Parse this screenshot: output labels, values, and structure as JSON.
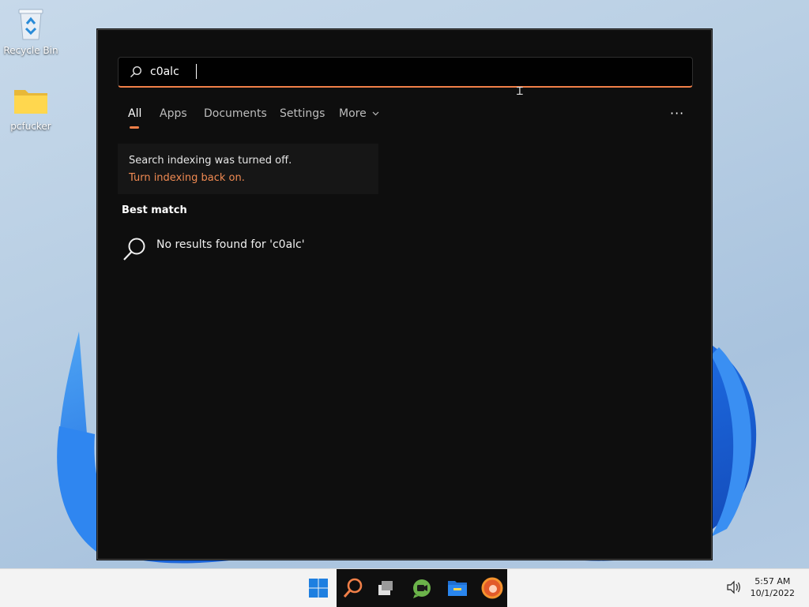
{
  "desktop": {
    "icons": [
      {
        "label": "Recycle Bin",
        "icon": "recycle-bin-icon"
      },
      {
        "label": "pcfucker",
        "icon": "folder-icon"
      }
    ]
  },
  "search": {
    "query": "c0alc",
    "tabs": [
      {
        "label": "All",
        "active": true
      },
      {
        "label": "Apps"
      },
      {
        "label": "Documents"
      },
      {
        "label": "Settings"
      },
      {
        "label": "More",
        "icon": "chevron-down-icon"
      }
    ],
    "more_options_label": "···",
    "notice": {
      "message": "Search indexing was turned off.",
      "link": "Turn indexing back on."
    },
    "best_match_label": "Best match",
    "no_results_text": "No results found for 'c0alc'"
  },
  "taskbar": {
    "apps": [
      {
        "name": "start",
        "icon": "windows-logo-icon"
      },
      {
        "name": "search",
        "icon": "search-icon",
        "active": true
      },
      {
        "name": "task-view",
        "icon": "task-view-icon"
      },
      {
        "name": "chat",
        "icon": "chat-icon"
      },
      {
        "name": "file-explorer",
        "icon": "folder-icon"
      },
      {
        "name": "edge",
        "icon": "edge-icon"
      }
    ],
    "tray": {
      "volume_icon": "speaker-icon",
      "time": "5:57 AM",
      "date": "10/1/2022"
    }
  },
  "colors": {
    "accent": "#f07f48",
    "flyout_bg": "#0e0e0e",
    "link": "#f08a52",
    "taskbar_bg": "#f3f3f3"
  }
}
